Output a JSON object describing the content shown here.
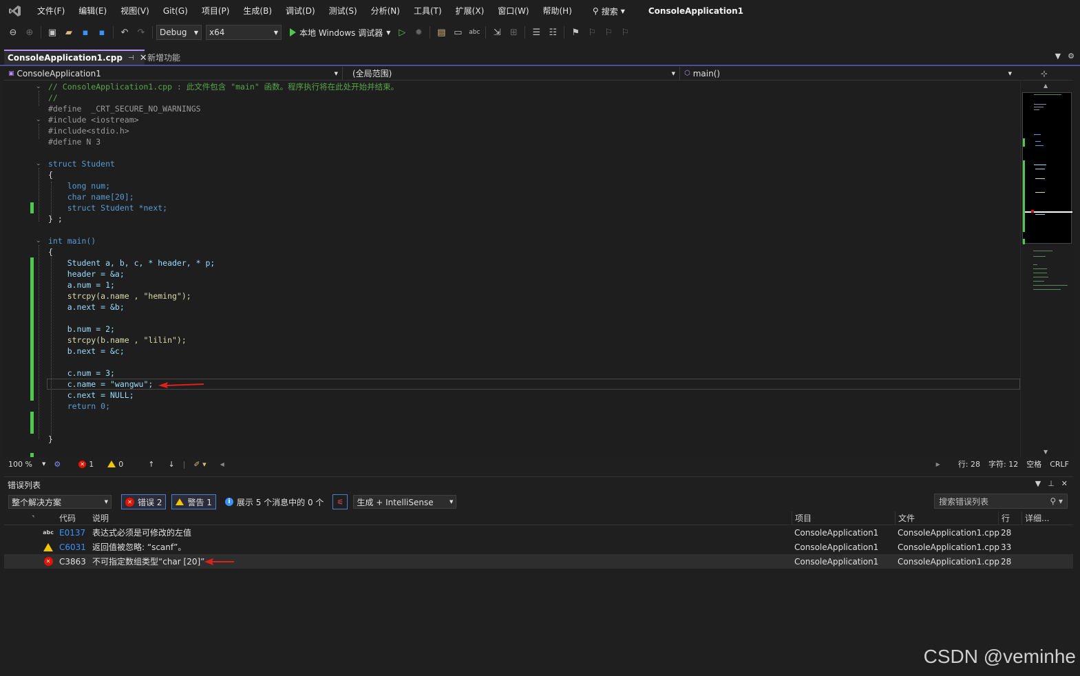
{
  "menu": {
    "items": [
      "文件(F)",
      "编辑(E)",
      "视图(V)",
      "Git(G)",
      "项目(P)",
      "生成(B)",
      "调试(D)",
      "测试(S)",
      "分析(N)",
      "工具(T)",
      "扩展(X)",
      "窗口(W)",
      "帮助(H)"
    ],
    "search_label": "搜索",
    "app_title": "ConsoleApplication1"
  },
  "toolbar": {
    "config": "Debug",
    "platform": "x64",
    "run_label": "本地 Windows 调试器"
  },
  "tabs": {
    "active": "ConsoleApplication1.cpp",
    "inactive": "新增功能"
  },
  "navbar": {
    "project": "ConsoleApplication1",
    "scope": "(全局范围)",
    "member": "main()"
  },
  "code": [
    "// ConsoleApplication1.cpp : 此文件包含 \"main\" 函数。程序执行将在此处开始并结束。",
    "//",
    "#define  _CRT_SECURE_NO_WARNINGS",
    "#include <iostream>",
    "#include<stdio.h>",
    "#define N 3",
    "",
    "struct Student",
    "{",
    "    long num;",
    "    char name[20];",
    "    struct Student *next;",
    "} ;",
    "",
    "int main()",
    "{",
    "    Student a, b, c, * header, * p;",
    "    header = &a;",
    "    a.num = 1;",
    "    strcpy(a.name , \"heming\");",
    "    a.next = &b;",
    "",
    "    b.num = 2;",
    "    strcpy(b.name , \"lilin\");",
    "    b.next = &c;",
    "",
    "    c.num = 3;",
    "    c.name = \"wangwu\";",
    "    c.next = NULL;",
    "    return 0;",
    "",
    "",
    "}"
  ],
  "editor_status": {
    "zoom": "100 %",
    "errors": "1",
    "warnings": "0",
    "line": "行: 28",
    "char": "字符: 12",
    "spaces": "空格",
    "eol": "CRLF"
  },
  "error_list": {
    "title": "错误列表",
    "scope": "整个解决方案",
    "errors_btn": "错误 2",
    "warnings_btn": "警告 1",
    "messages_btn": "展示 5 个消息中的 0 个",
    "build_filter": "生成 + IntelliSense",
    "search_placeholder": "搜索错误列表",
    "columns": [
      "代码",
      "说明",
      "项目",
      "文件",
      "行",
      "详细..."
    ],
    "rows": [
      {
        "icon": "abc",
        "code": "E0137",
        "desc": "表达式必须是可修改的左值",
        "project": "ConsoleApplication1",
        "file": "ConsoleApplication1.cpp",
        "line": "28"
      },
      {
        "icon": "warning",
        "code": "C6031",
        "desc": "返回值被忽略: “scanf”。",
        "project": "ConsoleApplication1",
        "file": "ConsoleApplication1.cpp",
        "line": "33"
      },
      {
        "icon": "error",
        "code": "C3863",
        "desc": "不可指定数组类型“char [20]”",
        "project": "ConsoleApplication1",
        "file": "ConsoleApplication1.cpp",
        "line": "28"
      }
    ]
  },
  "watermark": "CSDN @veminhe",
  "colors": {
    "accent": "#b48ef5",
    "change_bar": "#4ec94e",
    "error": "#e51400",
    "warning": "#f2c500",
    "link": "#3794ff",
    "annotation_arrow": "#e0201a"
  }
}
